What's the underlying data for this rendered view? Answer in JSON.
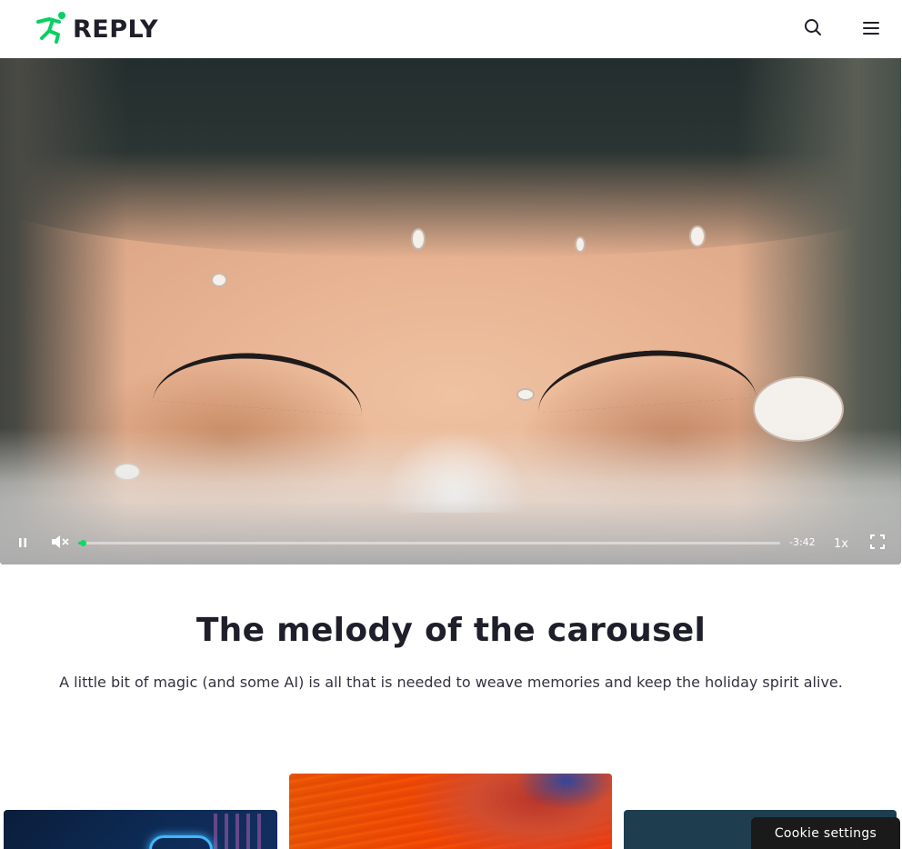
{
  "header": {
    "logo_text": "REPLY",
    "logo_icon": "runner-logo-icon",
    "search_icon": "search-icon",
    "menu_icon": "hamburger-menu-icon",
    "brand_color": "#0acf62"
  },
  "video": {
    "play_state_icon": "pause-icon",
    "mute_icon": "volume-muted-icon",
    "progress_fraction": 0.005,
    "time_remaining": "-3:42",
    "speed": "1x",
    "fullscreen_icon": "fullscreen-icon"
  },
  "intro": {
    "title": "The melody of the carousel",
    "subtitle": "A little bit of magic (and some AI) is all that is needed to weave memories and keep the holiday spirit alive."
  },
  "cookie": {
    "label": "Cookie settings"
  }
}
